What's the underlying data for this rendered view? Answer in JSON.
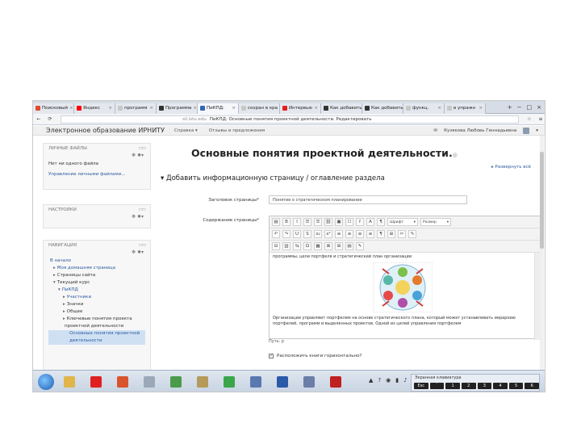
{
  "browser": {
    "tabs": [
      {
        "label": "Поисковый",
        "color": "#e04a2f"
      },
      {
        "label": "Яндекс",
        "color": "#ff0000"
      },
      {
        "label": "программ",
        "color": "#c8c8c8"
      },
      {
        "label": "Программа",
        "color": "#333333"
      },
      {
        "label": "ПиКПД:",
        "color": "#3266b5"
      },
      {
        "label": "сохран в кра",
        "color": "#c8c8c8"
      },
      {
        "label": "Интервью",
        "color": "#e02020"
      },
      {
        "label": "Как добавить",
        "color": "#333333"
      },
      {
        "label": "Как добавить",
        "color": "#333333"
      },
      {
        "label": "функц.",
        "color": "#c8c8c8"
      },
      {
        "label": "в упражн",
        "color": "#c8c8c8"
      }
    ],
    "url_host": "sil.istu.edu",
    "url_text": "ПиКПД: Основные понятия проектной деятельности. Редактировать",
    "window_controls": [
      "+",
      "−",
      "□",
      "×"
    ]
  },
  "site": {
    "brand": "Электронное образование ИРНИТУ",
    "menu": [
      "Справка ▾",
      "Отзывы и предложения"
    ],
    "user_name": "Кузякова Любовь Геннадьевна"
  },
  "left": {
    "personal_files": {
      "title": "ЛИЧНЫЕ ФАЙЛЫ",
      "empty_text": "Нет ни одного файла",
      "manage_link": "Управление личными файлами..."
    },
    "settings": {
      "title": "НАСТРОЙКИ"
    },
    "navigation": {
      "title": "НАВИГАЦИЯ",
      "items": [
        {
          "text": "В начало",
          "indent": 0,
          "arrow": "",
          "link": true,
          "selected": false
        },
        {
          "text": "Моя домашняя страница",
          "indent": 1,
          "arrow": "▸",
          "link": true,
          "selected": false
        },
        {
          "text": "Страницы сайта",
          "indent": 1,
          "arrow": "▸",
          "link": false,
          "selected": false
        },
        {
          "text": "Текущий курс",
          "indent": 1,
          "arrow": "▾",
          "link": false,
          "selected": false
        },
        {
          "text": "ПиКПД",
          "indent": 2,
          "arrow": "▾",
          "link": true,
          "selected": false
        },
        {
          "text": "Участники",
          "indent": 3,
          "arrow": "▸",
          "link": true,
          "selected": false
        },
        {
          "text": "Значки",
          "indent": 3,
          "arrow": "▸",
          "link": false,
          "selected": false
        },
        {
          "text": "Общее",
          "indent": 3,
          "arrow": "▸",
          "link": false,
          "selected": false
        },
        {
          "text": "Ключевые понятия проекта",
          "indent": 3,
          "arrow": "▸",
          "link": false,
          "selected": false
        },
        {
          "text": "проектной деятельности",
          "indent": 3,
          "arrow": "",
          "link": false,
          "selected": false
        },
        {
          "text": "Основные понятия проектной",
          "indent": 4,
          "arrow": "",
          "link": true,
          "selected": true
        },
        {
          "text": "деятельности",
          "indent": 4,
          "arrow": "",
          "link": true,
          "selected": true
        }
      ]
    },
    "block_controls": "✥ ✹▾",
    "dock_glyph": "▭▭"
  },
  "main": {
    "title": "Основные понятия проектной деятельности.",
    "help_glyph": "◎",
    "right_link": "▸ Развернуть всё",
    "section_heading": "▾ Добавить информационную страницу / оглавление раздела",
    "page_title_label": "Заголовок страницы*",
    "page_title_value": "Понятие о стратегическом планировании",
    "content_label": "Содержание страницы*",
    "editor": {
      "font_select": "Шрифт",
      "size_select": "Размер",
      "row1": [
        "▤",
        "B",
        "I",
        "☰",
        "☰",
        "⛓",
        "▣",
        "☐",
        "f",
        "A",
        "¶"
      ],
      "row2": [
        "↶",
        "↷",
        "U",
        "S",
        "x₂",
        "x²",
        "≡",
        "≡",
        "≡",
        "≡",
        "¶",
        "⊞",
        "✂",
        "✎"
      ],
      "row3": [
        "⊟",
        "▥",
        "⇆",
        "Ω",
        "▦",
        "⊠",
        "⊞",
        "▤",
        "✎"
      ],
      "body_line1": "программы, цели портфеля и стратегический план организации",
      "body_text2": "Организации управляют портфелем на основе стратегического плана, который может устанавливать иерархию портфелей, программ и выделенных проектов. Одной из целей управления портфелем",
      "status": "Путь: p"
    },
    "checkbox_label": "Расположить книги горизонтально?"
  },
  "taskbar": {
    "icons": [
      {
        "name": "explorer-icon",
        "color": "#e0b54a"
      },
      {
        "name": "yandex-icon",
        "color": "#e02020"
      },
      {
        "name": "browser-icon",
        "color": "#d9542c"
      },
      {
        "name": "media-icon",
        "color": "#9aa8b8"
      },
      {
        "name": "recycle-icon",
        "color": "#4b9b4b"
      },
      {
        "name": "files-icon",
        "color": "#b59a5a"
      },
      {
        "name": "sync-icon",
        "color": "#3aa64a"
      },
      {
        "name": "network-icon",
        "color": "#5a78b0"
      },
      {
        "name": "word-icon",
        "color": "#2b5aa8"
      },
      {
        "name": "paint-icon",
        "color": "#6a7ea8"
      },
      {
        "name": "pdf-icon",
        "color": "#c02020"
      }
    ],
    "tray": [
      "▲",
      "?",
      "◉",
      "▮",
      "♪"
    ],
    "lang_title": "Экранная клавиатура",
    "keys": [
      "Esc",
      "`",
      "1",
      "2",
      "3",
      "4",
      "5",
      "6"
    ]
  }
}
